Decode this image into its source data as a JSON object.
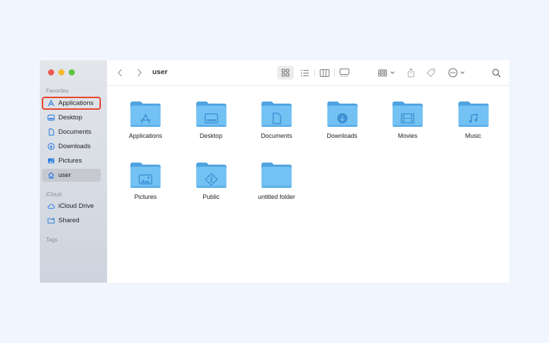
{
  "window": {
    "path_title": "user",
    "traffic_lights": [
      "close",
      "minimize",
      "zoom"
    ]
  },
  "sidebar": {
    "sections": [
      {
        "label": "Favorites"
      },
      {
        "label": "iCloud"
      },
      {
        "label": "Tags"
      }
    ],
    "favorites": [
      {
        "label": "Applications",
        "icon": "app-store-icon",
        "highlighted": true
      },
      {
        "label": "Desktop",
        "icon": "desktop-icon"
      },
      {
        "label": "Documents",
        "icon": "document-icon"
      },
      {
        "label": "Downloads",
        "icon": "download-icon"
      },
      {
        "label": "Pictures",
        "icon": "pictures-icon"
      },
      {
        "label": "user",
        "icon": "home-icon",
        "selected": true
      }
    ],
    "icloud": [
      {
        "label": "iCloud Drive",
        "icon": "cloud-icon"
      },
      {
        "label": "Shared",
        "icon": "shared-folder-icon"
      }
    ]
  },
  "toolbar": {
    "back": "chevron-left-icon",
    "forward": "chevron-right-icon",
    "views": [
      "icon-view",
      "list-view",
      "column-view",
      "gallery-view"
    ],
    "active_view": "icon-view",
    "group": "group-icon",
    "share": "share-icon",
    "tag": "tag-icon",
    "more": "ellipsis-circle-icon",
    "search": "search-icon"
  },
  "items": [
    {
      "label": "Applications",
      "glyph": "app-store"
    },
    {
      "label": "Desktop",
      "glyph": "desktop"
    },
    {
      "label": "Documents",
      "glyph": "document"
    },
    {
      "label": "Downloads",
      "glyph": "download"
    },
    {
      "label": "Movies",
      "glyph": "film"
    },
    {
      "label": "Music",
      "glyph": "music"
    },
    {
      "label": "Pictures",
      "glyph": "picture"
    },
    {
      "label": "Public",
      "glyph": "public"
    },
    {
      "label": "untitled folder",
      "glyph": "none"
    }
  ],
  "colors": {
    "folder_body": "#74c2f4",
    "folder_tab": "#4fa3e0",
    "folder_glyph": "#3d92d3",
    "highlight_border": "#e8402b",
    "sidebar_icon": "#2f7be0"
  }
}
